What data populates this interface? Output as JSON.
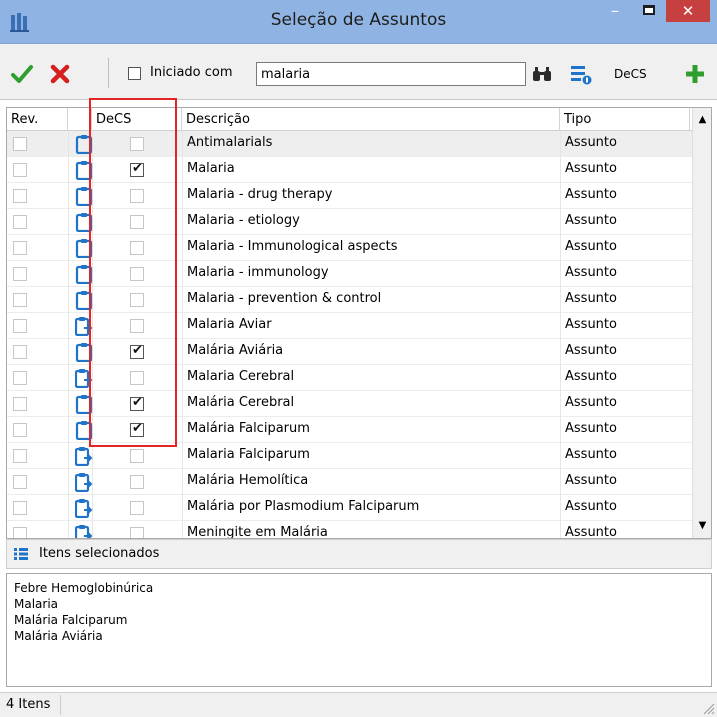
{
  "window": {
    "title": "Seleção de Assuntos",
    "minimize": "–",
    "close": "✕"
  },
  "toolbar": {
    "filter_label": "Iniciado com",
    "search_value": "malaria",
    "decs_label": "DeCS"
  },
  "grid": {
    "columns": {
      "rev": "Rev.",
      "decs": "DeCS",
      "descricao": "Descrição",
      "tipo": "Tipo"
    },
    "rows": [
      {
        "descricao": "Antimalarials",
        "tipo": "Assunto",
        "rev": false,
        "decs": false,
        "icon": "clipboard-icon",
        "selected": true
      },
      {
        "descricao": "Malaria",
        "tipo": "Assunto",
        "rev": false,
        "decs": true,
        "icon": "clipboard-icon"
      },
      {
        "descricao": "Malaria - drug therapy",
        "tipo": "Assunto",
        "rev": false,
        "decs": false,
        "icon": "clipboard-icon"
      },
      {
        "descricao": "Malaria - etiology",
        "tipo": "Assunto",
        "rev": false,
        "decs": false,
        "icon": "clipboard-icon"
      },
      {
        "descricao": "Malaria - Immunological aspects",
        "tipo": "Assunto",
        "rev": false,
        "decs": false,
        "icon": "clipboard-icon"
      },
      {
        "descricao": "Malaria - immunology",
        "tipo": "Assunto",
        "rev": false,
        "decs": false,
        "icon": "clipboard-icon"
      },
      {
        "descricao": "Malaria - prevention & control",
        "tipo": "Assunto",
        "rev": false,
        "decs": false,
        "icon": "clipboard-icon"
      },
      {
        "descricao": "Malaria Aviar",
        "tipo": "Assunto",
        "rev": false,
        "decs": false,
        "icon": "clipboard-arrow-icon"
      },
      {
        "descricao": "Malária Aviária",
        "tipo": "Assunto",
        "rev": false,
        "decs": true,
        "icon": "clipboard-icon"
      },
      {
        "descricao": "Malaria Cerebral",
        "tipo": "Assunto",
        "rev": false,
        "decs": false,
        "icon": "clipboard-arrow-icon"
      },
      {
        "descricao": "Malária Cerebral",
        "tipo": "Assunto",
        "rev": false,
        "decs": true,
        "icon": "clipboard-icon"
      },
      {
        "descricao": "Malária Falciparum",
        "tipo": "Assunto",
        "rev": false,
        "decs": true,
        "icon": "clipboard-icon"
      },
      {
        "descricao": "Malaria Falciparum",
        "tipo": "Assunto",
        "rev": false,
        "decs": false,
        "icon": "clipboard-arrow-icon"
      },
      {
        "descricao": "Malária Hemolítica",
        "tipo": "Assunto",
        "rev": false,
        "decs": false,
        "icon": "clipboard-arrow-icon"
      },
      {
        "descricao": "Malária por Plasmodium Falciparum",
        "tipo": "Assunto",
        "rev": false,
        "decs": false,
        "icon": "clipboard-arrow-icon"
      },
      {
        "descricao": "Meningite em Malária",
        "tipo": "Assunto",
        "rev": false,
        "decs": false,
        "icon": "clipboard-arrow-icon"
      }
    ]
  },
  "selected_panel": {
    "title": "Itens selecionados",
    "items": [
      "Febre Hemoglobinúrica",
      "Malaria",
      "Malária Falciparum",
      "Malária Aviária"
    ]
  },
  "status": {
    "count_text": "4 Itens"
  },
  "colors": {
    "titlebar": "#8fb4e3",
    "close_button": "#c64040",
    "confirm_green": "#2e9e2e",
    "cancel_red": "#d61f1f",
    "highlight_red": "#e52525",
    "icon_blue": "#1f73c9"
  }
}
